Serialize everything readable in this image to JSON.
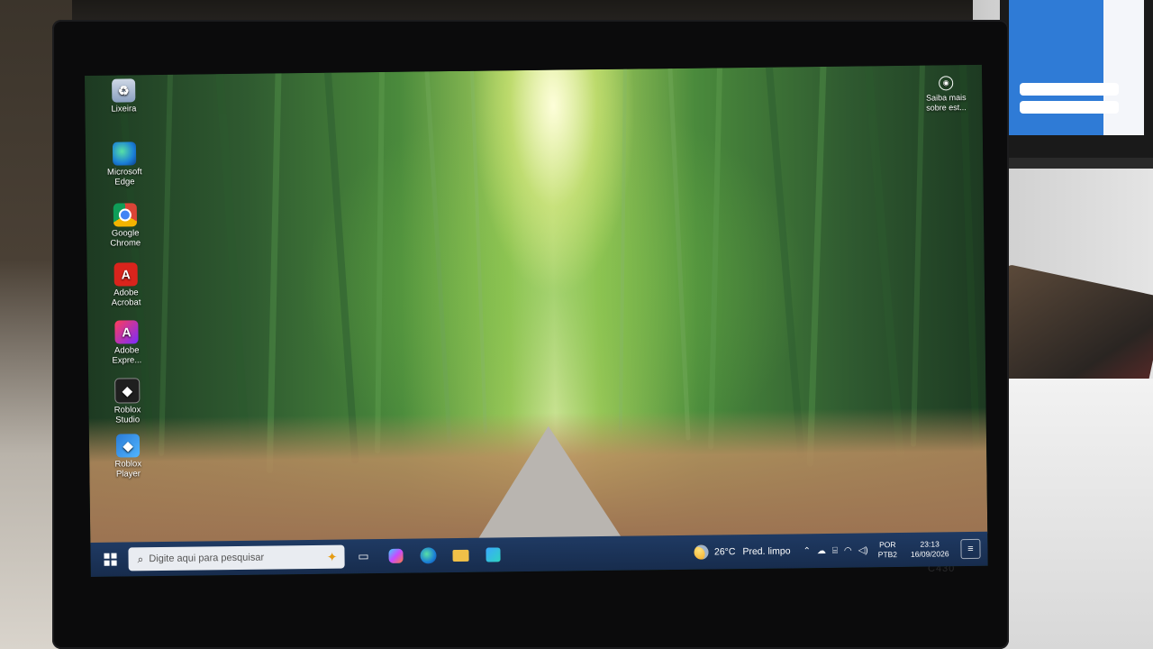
{
  "desktop": {
    "icons": [
      {
        "label": "Lixeira",
        "icon": "recycle-bin-icon",
        "glyph": "♻"
      },
      {
        "label": "Microsoft Edge",
        "icon": "edge-icon",
        "glyph": ""
      },
      {
        "label": "Google Chrome",
        "icon": "chrome-icon",
        "glyph": ""
      },
      {
        "label": "Adobe Acrobat",
        "icon": "acrobat-icon",
        "glyph": "A"
      },
      {
        "label": "Adobe Expre...",
        "icon": "adobe-express-icon",
        "glyph": "A"
      },
      {
        "label": "Roblox Studio",
        "icon": "roblox-studio-icon",
        "glyph": "◆"
      },
      {
        "label": "Roblox Player",
        "icon": "roblox-player-icon",
        "glyph": "◆"
      }
    ],
    "widget": {
      "label": "Saiba mais sobre est...",
      "icon": "camera-icon"
    }
  },
  "taskbar": {
    "start_icon": "windows-logo-icon",
    "search_placeholder": "Digite aqui para pesquisar",
    "pinned": [
      "task-view-icon",
      "copilot-icon",
      "edge-icon",
      "file-explorer-icon",
      "microsoft-store-icon"
    ],
    "weather": {
      "temp": "26°C",
      "desc": "Pred. limpo"
    },
    "tray_icons": [
      "chevron-up-icon",
      "onedrive-icon",
      "network-icon",
      "wifi-icon",
      "volume-icon"
    ],
    "language": {
      "line1": "POR",
      "line2": "PTB2"
    },
    "clock": {
      "time": "23:13",
      "date": "16/09/2026"
    },
    "notification_icon": "notification-icon"
  },
  "monitor": {
    "model": "C430"
  },
  "colors": {
    "taskbar": "#1f3a63",
    "search_bg": "#e9ecf1"
  }
}
